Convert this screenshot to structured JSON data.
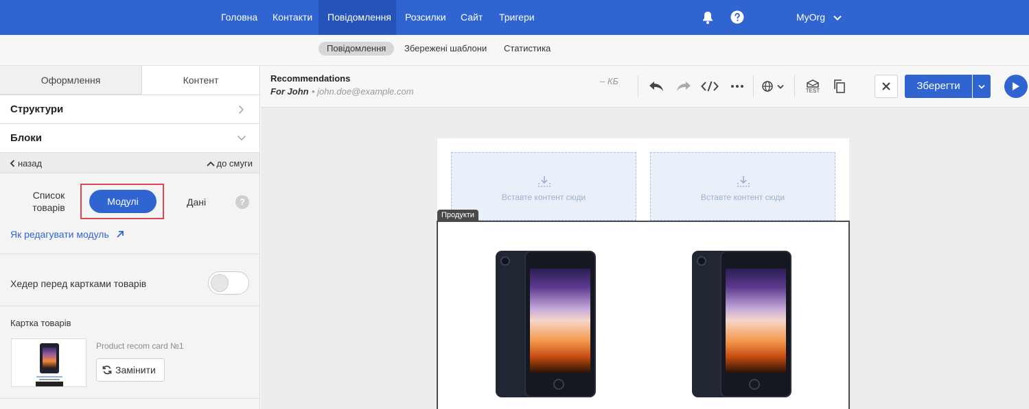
{
  "topnav": {
    "items": [
      "Головна",
      "Контакти",
      "Повідомлення",
      "Розсилки",
      "Сайт",
      "Тригери"
    ],
    "org": "MyOrg"
  },
  "subnav": {
    "items": [
      "Повідомлення",
      "Збережені шаблони",
      "Статистика"
    ]
  },
  "sidebar": {
    "tabs": [
      "Оформлення",
      "Контент"
    ],
    "structures": "Структури",
    "blocks": "Блоки",
    "back": "назад",
    "to_stripe": "до смуги",
    "modes": {
      "list": "Список товарів",
      "modules": "Модулі",
      "data": "Дані"
    },
    "help_link": "Як редагувати модуль",
    "header_toggle_label": "Хедер перед картками товарів",
    "card_section_title": "Картка товарів",
    "card_name": "Product recom card №1",
    "replace": "Замінити"
  },
  "toolbar": {
    "title": "Recommendations",
    "recipient": "For John",
    "email": "john.doe@example.com",
    "size": "– КБ",
    "test_label": "TEST",
    "save": "Зберегти"
  },
  "canvas": {
    "dropzone_text": "Вставте контент сюди",
    "products_tag": "Продукти"
  },
  "colors": {
    "primary": "#2f64d1",
    "highlight_border": "#e0454f",
    "link": "#2f64d1"
  }
}
